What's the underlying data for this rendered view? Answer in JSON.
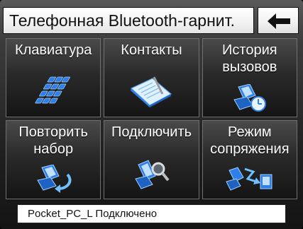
{
  "header": {
    "title": "Телефонная Bluetooth-гарнит.",
    "back_icon": "arrow-left-icon"
  },
  "menu": {
    "items": [
      {
        "label": "Клавиатура",
        "icon": "keypad-icon"
      },
      {
        "label": "Контакты",
        "icon": "address-book-icon"
      },
      {
        "label": "История\nвызовов",
        "icon": "call-history-icon"
      },
      {
        "label": "Повторить\nнабор",
        "icon": "redial-icon"
      },
      {
        "label": "Подключить",
        "icon": "connect-phone-icon"
      },
      {
        "label": "Режим\nсопряжения",
        "icon": "pairing-icon"
      }
    ]
  },
  "status": {
    "text": "Pocket_PC_L Подключено"
  },
  "colors": {
    "icon_blue": "#2f7fe8",
    "icon_light": "#9fd0ff",
    "text": "#ffffff"
  }
}
